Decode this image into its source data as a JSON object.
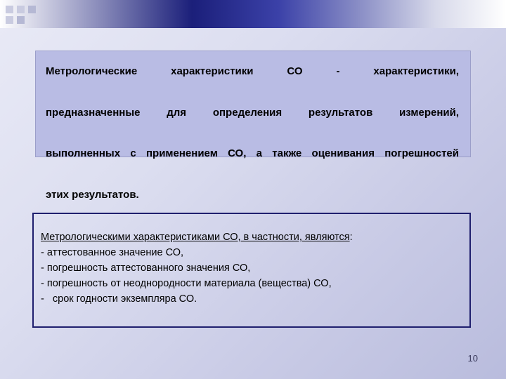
{
  "slide": {
    "page_number": "10",
    "main_box": {
      "paragraph_lines": [
        "Метрологические характеристики СО - характеристики,",
        "предназначенные для определения результатов измерений,",
        "выполненных с применением СО, а также оценивания погрешностей",
        "этих результатов."
      ],
      "full_text": "Метрологические характеристики СО - характеристики, предназначенные для определения результатов измерений, выполненных с применением СО, а также оценивания погрешностей этих результатов."
    },
    "lower_box": {
      "intro_underlined": "Метрологическими характеристиками СО, в частности, являются",
      "intro_tail": ":",
      "items": [
        "- аттестованное значение СО,",
        "- погрешность аттестованного значения СО,",
        "- погрешность от неоднородности материала (вещества) СО,",
        "-   срок годности экземпляра СО."
      ]
    },
    "colors": {
      "band_dark": "#1b1f7a",
      "box_fill": "#b9bce4",
      "box_border": "#1f1f6e",
      "background": "#dcdef0"
    }
  }
}
